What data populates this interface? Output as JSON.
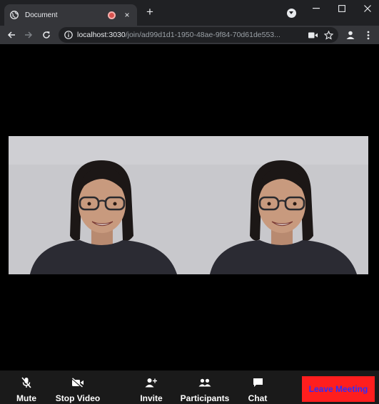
{
  "browser": {
    "tab": {
      "title": "Document",
      "close_glyph": "×"
    },
    "new_tab_glyph": "+",
    "url": {
      "host": "localhost:3030",
      "path": "/join/ad99d1d1-1950-48ae-9f84-70d61de553..."
    },
    "icons": [
      "globe-icon",
      "record-icon",
      "close-icon",
      "plus-icon",
      "tab-search-icon",
      "minimize-icon",
      "maximize-icon",
      "window-close-icon",
      "back-icon",
      "forward-icon",
      "reload-icon",
      "info-icon",
      "camera-icon",
      "bookmark-star-icon",
      "profile-icon",
      "kebab-menu-icon"
    ]
  },
  "video": {
    "tiles": [
      "participant-video-left",
      "participant-video-right"
    ]
  },
  "controls": {
    "mute": {
      "label": "Mute",
      "icon": "mic-off-icon"
    },
    "stop_video": {
      "label": "Stop Video",
      "icon": "video-off-icon"
    },
    "invite": {
      "label": "Invite",
      "icon": "add-person-icon"
    },
    "participants": {
      "label": "Participants",
      "icon": "people-icon"
    },
    "chat": {
      "label": "Chat",
      "icon": "chat-bubble-icon"
    },
    "leave": {
      "label": "Leave Meeting"
    }
  },
  "colors": {
    "leave_bg": "#ff1e1e",
    "leave_text": "#2d2dff",
    "control_bar": "#1a1a1a",
    "stage_bg": "#000000"
  }
}
